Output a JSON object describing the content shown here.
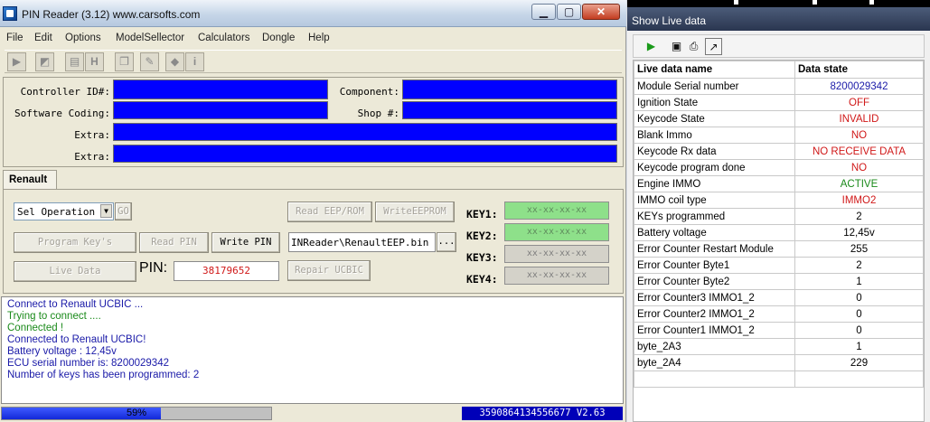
{
  "main_window": {
    "title": "PIN Reader (3.12) www.carsofts.com",
    "controls": {
      "minimize": "▁",
      "maximize": "▢",
      "close": "✕"
    }
  },
  "menu": [
    "File",
    "Edit",
    "Options",
    "ModelSellector",
    "Calculators",
    "Dongle",
    "Help"
  ],
  "toolbar_icons": [
    "play-icon",
    "chart-icon",
    "memory-icon",
    "hex-icon",
    "copy-icon",
    "eraser-icon",
    "info-icon"
  ],
  "fields": {
    "controller_id_label": "Controller ID#:",
    "component_label": "Component:",
    "software_coding_label": "Software Coding:",
    "shop_label": "Shop #:",
    "extra1_label": "Extra:",
    "extra2_label": "Extra:"
  },
  "tab": {
    "label": "Renault"
  },
  "renault": {
    "operation_select": "Sel Operation",
    "go_button": "GO",
    "read_eeprom_button": "Read EEP/ROM",
    "write_eeprom_button": "WriteEEPROM",
    "program_keys_button": "Program Key's",
    "read_pin_button": "Read PIN",
    "write_pin_button": "Write PIN",
    "file_path": "INReader\\RenaultEEP.bin",
    "browse_button": "...",
    "live_data_button": "Live Data",
    "pin_label": "PIN:",
    "pin_value": "38179652",
    "repair_button": "Repair UCBIC",
    "keys": [
      {
        "label": "KEY1:",
        "value": "xx-xx-xx-xx",
        "state": "green"
      },
      {
        "label": "KEY2:",
        "value": "xx-xx-xx-xx",
        "state": "green"
      },
      {
        "label": "KEY3:",
        "value": "xx-xx-xx-xx",
        "state": "grey"
      },
      {
        "label": "KEY4:",
        "value": "xx-xx-xx-xx",
        "state": "grey"
      }
    ]
  },
  "log": [
    {
      "text": "Connect to Renault UCBIC ...",
      "color": "#1a1aa8"
    },
    {
      "text": "Trying to connect ....",
      "color": "#1a8a1a"
    },
    {
      "text": "Connected !",
      "color": "#1a8a1a"
    },
    {
      "text": "Connected to Renault UCBIC!",
      "color": "#1a1aa8"
    },
    {
      "text": "Battery voltage : 12,45v",
      "color": "#1a1aa8"
    },
    {
      "text": "ECU serial number is: 8200029342",
      "color": "#1a1aa8"
    },
    {
      "text": "Number of keys has been programmed: 2",
      "color": "#1a1aa8"
    }
  ],
  "status": {
    "progress_percent": 59,
    "progress_text": "59%",
    "serial": "3590864134556677 V2.63"
  },
  "live_window": {
    "title": "Show Live data",
    "toolbar_icons": [
      "play-icon",
      "save-icon",
      "print-icon",
      "chart-icon"
    ],
    "headers": [
      "Live data name",
      "Data state"
    ],
    "rows": [
      {
        "name": "Module Serial number",
        "value": "8200029342",
        "color": "#1a1aa8"
      },
      {
        "name": "Ignition State",
        "value": "OFF",
        "color": "#d01818"
      },
      {
        "name": "Keycode State",
        "value": "INVALID",
        "color": "#d01818"
      },
      {
        "name": "Blank Immo",
        "value": "NO",
        "color": "#d01818"
      },
      {
        "name": "Keycode Rx data",
        "value": "NO RECEIVE DATA",
        "color": "#d01818"
      },
      {
        "name": "Keycode program done",
        "value": "NO",
        "color": "#d01818"
      },
      {
        "name": "Engine IMMO",
        "value": "ACTIVE",
        "color": "#1a8a1a"
      },
      {
        "name": "IMMO coil type",
        "value": "IMMO2",
        "color": "#d01818"
      },
      {
        "name": "KEYs programmed",
        "value": "2",
        "color": "#000000"
      },
      {
        "name": "Battery voltage",
        "value": "12,45v",
        "color": "#000000"
      },
      {
        "name": "Error Counter Restart Module",
        "value": "255",
        "color": "#000000"
      },
      {
        "name": "Error Counter Byte1",
        "value": "2",
        "color": "#000000"
      },
      {
        "name": "Error Counter Byte2",
        "value": "1",
        "color": "#000000"
      },
      {
        "name": "Error Counter3 IMMO1_2",
        "value": "0",
        "color": "#000000"
      },
      {
        "name": "Error Counter2 IMMO1_2",
        "value": "0",
        "color": "#000000"
      },
      {
        "name": "Error Counter1 IMMO1_2",
        "value": "0",
        "color": "#000000"
      },
      {
        "name": "byte_2A3",
        "value": "1",
        "color": "#000000"
      },
      {
        "name": "byte_2A4",
        "value": "229",
        "color": "#000000"
      }
    ]
  },
  "colors": {
    "field_blue": "#0000ff",
    "key_green": "#8ee08a",
    "status_blue": "#0000b8"
  }
}
